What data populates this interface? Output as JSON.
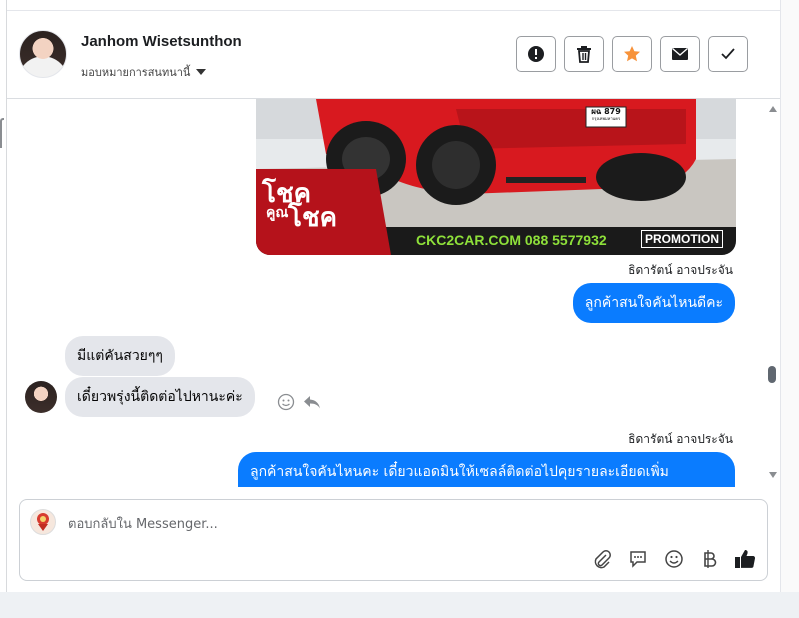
{
  "header": {
    "contact_name": "Janhom Wisetsunthon",
    "assign_label": "มอบหมายการสนทนานี้",
    "actions": [
      {
        "name": "spam-button",
        "icon": "alert-icon"
      },
      {
        "name": "delete-button",
        "icon": "trash-icon"
      },
      {
        "name": "star-button",
        "icon": "star-icon",
        "color": "#f7923a"
      },
      {
        "name": "mark-unread-button",
        "icon": "envelope-icon"
      },
      {
        "name": "mark-done-button",
        "icon": "checkmark-icon"
      }
    ]
  },
  "messages": {
    "image": {
      "brand_line1": "โชค",
      "brand_line2": "คูณ",
      "brand_line3": "โชค",
      "website_phone": "CKC2CAR.COM 088 5577932",
      "promo": "PROMOTION",
      "plate_top": "ผฉ 879",
      "plate_bottom": "กรุงเทพมหานคร"
    },
    "sender_1": "ธิดารัตน์ อาจประจัน",
    "outgoing_1": "ลูกค้าสนใจคันไหนดีคะ",
    "incoming_1": "มีแต่คันสวยๆๆ",
    "incoming_2": "เดี๋ยวพรุ่งนี้ติดต่อไปหานะค่ะ",
    "sender_2": "ธิดารัตน์ อาจประจัน",
    "outgoing_2": "ลูกค้าสนใจคันไหนคะ เดี๋ยวแอดมินให้เซลล์ติดต่อไปคุยรายละเอียดเพิ่ม"
  },
  "composer": {
    "placeholder": "ตอบกลับใน Messenger...",
    "tools": [
      "paperclip-icon",
      "speech-bubble-icon",
      "smiley-icon",
      "baht-icon",
      "thumbs-up-icon"
    ]
  }
}
